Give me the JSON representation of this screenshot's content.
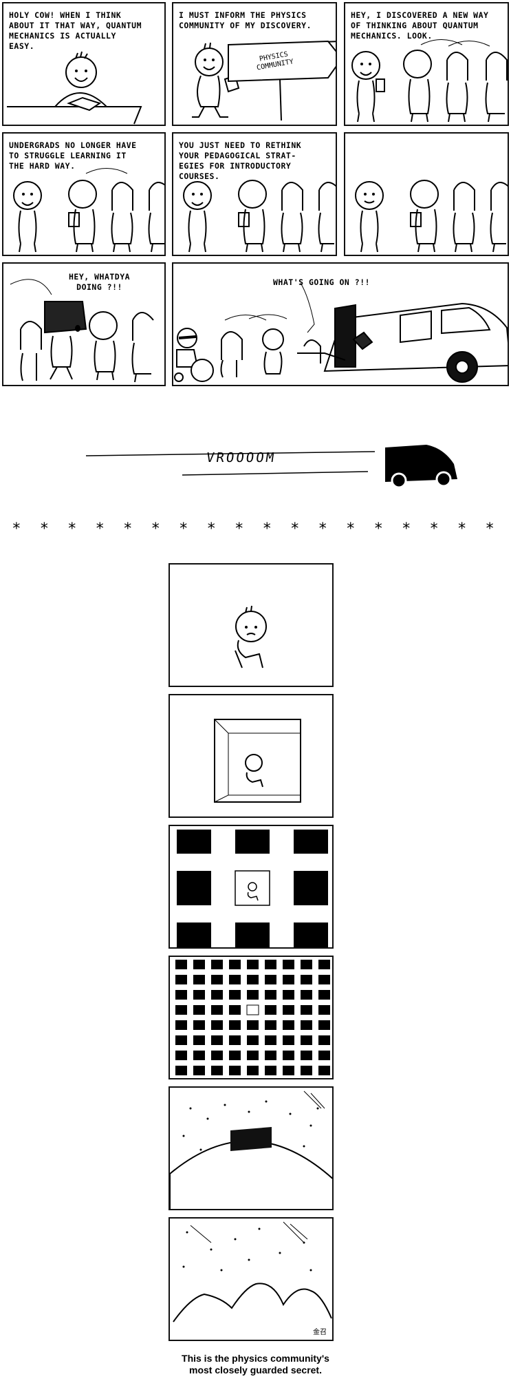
{
  "panels": {
    "p1": "HOLY COW! WHEN I THINK\nABOUT IT THAT WAY, QUANTUM\nMECHANICS IS ACTUALLY\nEASY.",
    "p2": "I MUST INFORM THE PHYSICS\nCOMMUNITY OF MY DISCOVERY.",
    "p2_sign": "PHYSICS\nCOMMUNITY",
    "p3": "HEY, I DISCOVERED A NEW WAY\nOF THINKING ABOUT QUANTUM\nMECHANICS. LOOK.",
    "p4": "UNDERGRADS NO LONGER HAVE\nTO STRUGGLE LEARNING IT\nTHE HARD WAY.",
    "p5": "YOU JUST NEED TO RETHINK\nYOUR PEDAGOGICAL STRAT-\nEGIES FOR INTRODUCTORY\n              COURSES.",
    "p7": "HEY, WHATDYA\nDOING ?!!",
    "p8": "WHAT'S GOING ON ?!!"
  },
  "sound": "VROOOOM",
  "separator": "* * * * * * * * * * * * * * * * * *",
  "footer": "This is the physics community's\nmost closely guarded secret.",
  "signature": "金召"
}
